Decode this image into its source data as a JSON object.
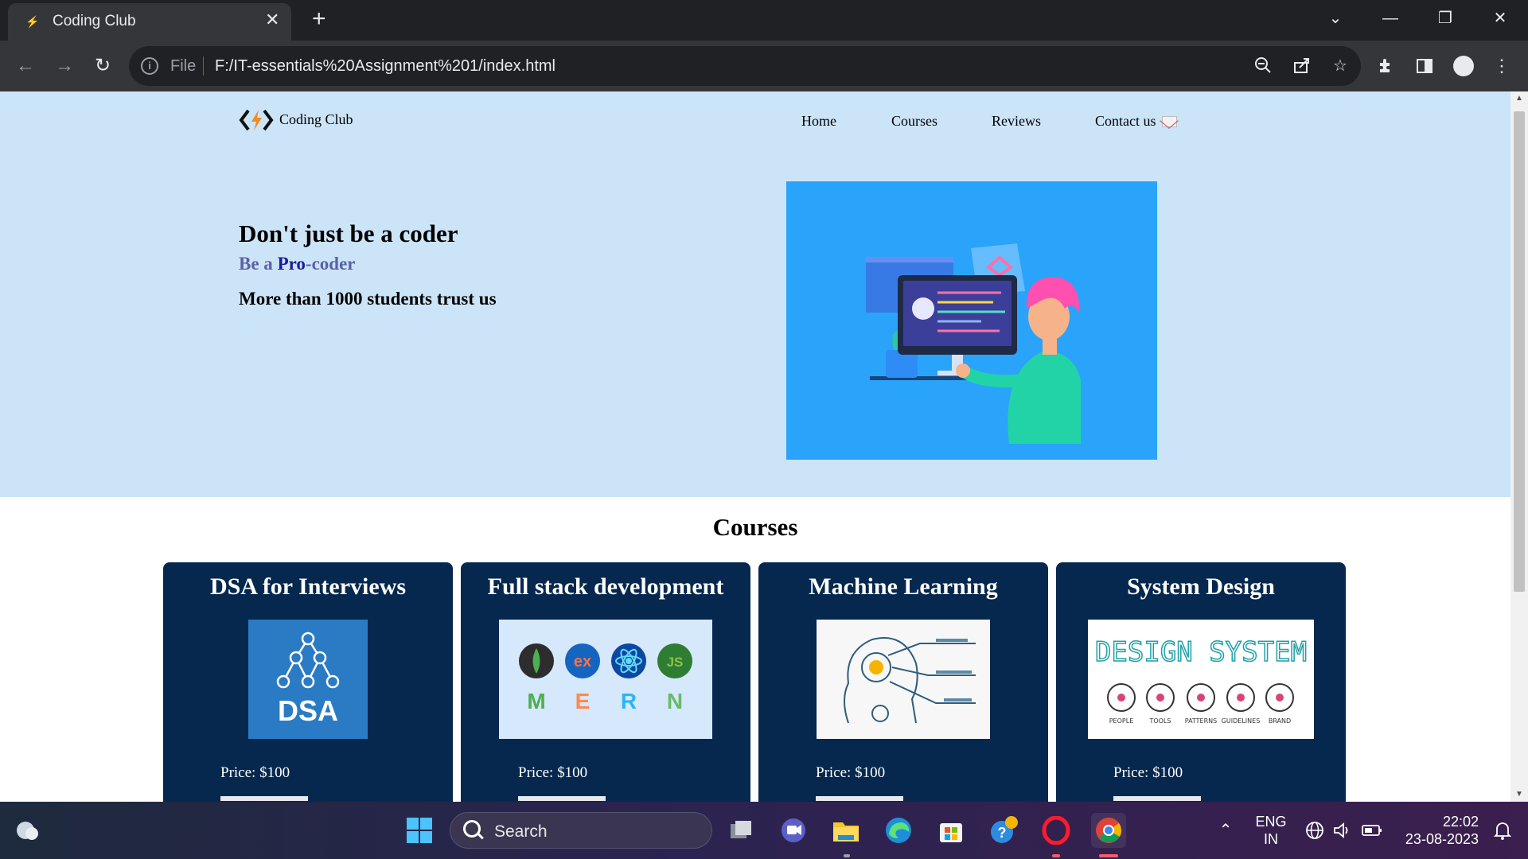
{
  "browser": {
    "tab_title": "Coding Club",
    "tab_close": "✕",
    "new_tab": "+",
    "omnibox_scheme": "File",
    "url": "F:/IT-essentials%20Assignment%201/index.html"
  },
  "page": {
    "logo_text": "Coding Club",
    "nav": {
      "home": "Home",
      "courses": "Courses",
      "reviews": "Reviews",
      "contact": "Contact us"
    },
    "hero": {
      "headline": "Don't just be a coder",
      "sub_before": "Be a ",
      "sub_pro": "Pro",
      "sub_after": "-coder",
      "trust": "More than 1000 students trust us"
    },
    "courses_heading": "Courses",
    "courses": [
      {
        "title": "DSA for Interviews",
        "image_text": "DSA",
        "price": "Price: $100"
      },
      {
        "title": "Full stack development",
        "image_text": "MERN",
        "price": "Price: $100"
      },
      {
        "title": "Machine Learning",
        "image_text": "",
        "price": "Price: $100"
      },
      {
        "title": "System Design",
        "image_text": "DESIGN SYSTEM",
        "price": "Price: $100"
      }
    ],
    "mern_letters": [
      "M",
      "E",
      "R",
      "N"
    ],
    "mern_badges": [
      "",
      "ex",
      "",
      "JS"
    ],
    "design_system_labels": [
      "PEOPLE",
      "TOOLS",
      "PATTERNS",
      "GUIDELINES",
      "BRAND"
    ]
  },
  "taskbar": {
    "search_label": "Search",
    "language": "ENG",
    "region": "IN",
    "time": "22:02",
    "date": "23-08-2023"
  },
  "colors": {
    "hero_bg": "#cce4f7",
    "card_bg": "#06284f",
    "art_bg": "#2aa3fb",
    "pro_accent": "#1a1aa3",
    "sub_accent": "#5a61a8"
  }
}
